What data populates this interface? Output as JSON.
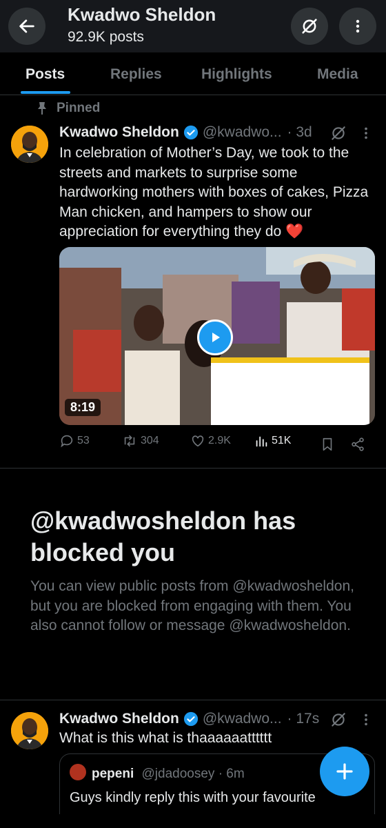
{
  "header": {
    "name": "Kwadwo Sheldon",
    "posts_count": "92.9K posts",
    "icons": [
      "back-arrow-icon",
      "grok-icon",
      "more-vertical-icon"
    ]
  },
  "tabs": [
    {
      "label": "Posts",
      "active": true
    },
    {
      "label": "Replies",
      "active": false
    },
    {
      "label": "Highlights",
      "active": false
    },
    {
      "label": "Media",
      "active": false
    }
  ],
  "pinned_post": {
    "pinned_label": "Pinned",
    "name": "Kwadwo Sheldon",
    "verified": true,
    "handle": "@kwadwo...",
    "time": "· 3d",
    "text": "In celebration of Mother’s Day, we took to the streets and markets to surprise some hardworking mothers with boxes of cakes, Pizza Man chicken, and hampers to show our appreciation for everything they do ❤️",
    "video_duration": "8:19",
    "stats": {
      "replies": "53",
      "reposts": "304",
      "likes": "2.9K",
      "views": "51K"
    }
  },
  "blocked": {
    "title": "@kwadwosheldon has blocked you",
    "description": "You can view public posts from @kwadwosheldon, but you are blocked from engaging with them. You also cannot follow or message @kwadwosheldon."
  },
  "second_post": {
    "name": "Kwadwo Sheldon",
    "handle": "@kwadwo...",
    "time": "· 17s",
    "text": "What is this what is thaaaaaatttttt",
    "quote": {
      "name": "pepeni",
      "handle": "@jdadoosey · 6m",
      "text": "Guys kindly reply this with your favourite"
    }
  },
  "colors": {
    "accent": "#1d9bf0",
    "background": "#000000",
    "secondary_text": "#71767b",
    "avatar": "#f5a20b"
  }
}
